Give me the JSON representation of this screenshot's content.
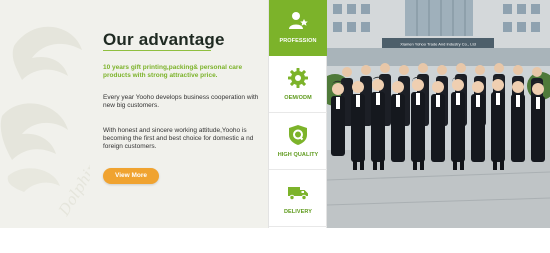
{
  "section": {
    "title": "Our advantage",
    "highlight": "10 years gift printing,packing& personal care products with strong attractive price.",
    "paragraphs": [
      "Every year Yooho develops business cooperation with new big customers.",
      "With honest and sincere working attitude,Yooho is becoming the first and best choice for domestic a nd foreign customers."
    ],
    "view_more_label": "View More"
  },
  "advantages": [
    {
      "label": "PROFESSION",
      "icon": "team-icon",
      "active": true
    },
    {
      "label": "OEM/ODM",
      "icon": "gear-icon",
      "active": false
    },
    {
      "label": "HIGH QUALITY",
      "icon": "quality-shield-icon",
      "active": false
    },
    {
      "label": "DELIVERY",
      "icon": "truck-icon",
      "active": false
    }
  ],
  "photo": {
    "building_sign": "Xiamen Yohoo Trade And Industry Co., Ltd"
  },
  "colors": {
    "accent_green": "#7cb32a",
    "button_orange": "#f0a330",
    "panel_bg": "#f1f1ec"
  }
}
